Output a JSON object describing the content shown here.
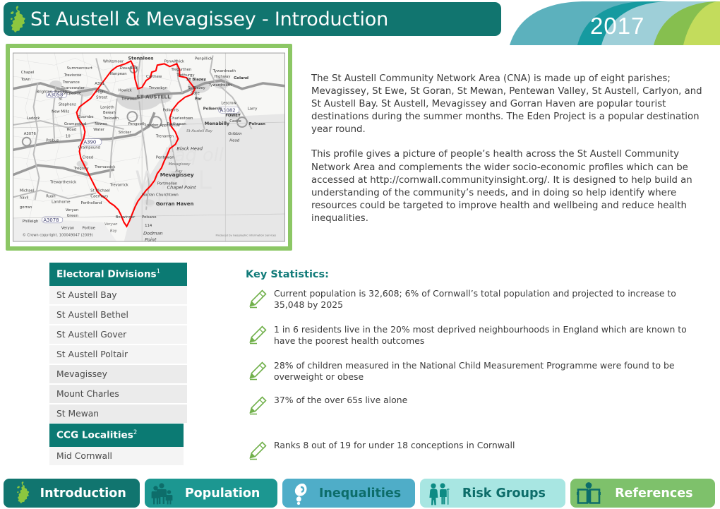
{
  "header": {
    "title": "St Austell & Mevagissey - Introduction",
    "year": "2017",
    "uk_icon": "uk-map-icon",
    "colors": {
      "title_bar": "#11756f",
      "swoosh_teal": "#5cb1bd",
      "swoosh_dark_teal": "#169aa0",
      "swoosh_light_teal": "#9ecfd8",
      "swoosh_green": "#86bf4f",
      "swoosh_light_green": "#c3dc5c"
    }
  },
  "map": {
    "name": "st-austell-cna-boundary-map",
    "boundary_color": "#ff0000",
    "frame_color": "#8cc765",
    "copyright": "© Crown copyright. 100049047 (2009)",
    "producer": "Produced by Geographic Information Services",
    "labels": [
      "Whitemoor",
      "Stenalees",
      "Penwithick",
      "Penpillick",
      "Nanpean",
      "Treviscoe",
      "Foxhole",
      "Carthew",
      "Tregurthen",
      "Trethurgy",
      "St Blazey",
      "Goland",
      "Chapel Town",
      "Scarcewater",
      "Stepaside",
      "St Stephens",
      "High Street",
      "Howick",
      "Trewoon",
      "Treverbyn",
      "St Blazey Gate",
      "Tywardreath Highway",
      "Tywardreath",
      "A3058",
      "New Mills",
      "Lanjeth",
      "Bethel",
      "Trewoth",
      "Par",
      "A3082",
      "Lescrow",
      "Ladock",
      "Coombe",
      "Trelowth",
      "Polkerris",
      "FOWEY",
      "Larry",
      "Grampound Road",
      "Nanpean",
      "Water",
      "Pengooth",
      "London Apprentice",
      "Charlestown",
      "Porthpean",
      "Menabilly",
      "Castle",
      "Polruan",
      "A390",
      "Probus",
      "Sticker",
      "Trenarren",
      "St Austell Bay",
      "Gribbin Head",
      "Grampound",
      "Creed",
      "Black Head",
      "Pentewan",
      "Mevagissey Bay",
      "Tregony",
      "Tremassick",
      "Mevagissey",
      "Portmellon",
      "Trewarthenick",
      "Trevarrick",
      "Chapel Point",
      "Gorran Churchtown",
      "St Michael Caerhays",
      "Ruan Lanihorne",
      "Portholland",
      "Gorran Haven",
      "Veryan Green",
      "Boswinger",
      "Polsano",
      "Philleigh",
      "A3078",
      "Portloe",
      "Veryan Bay",
      "Dodman Point",
      "ST AUSTELL",
      "CORNWALL COUNCIL",
      "114",
      "10"
    ]
  },
  "intro": {
    "paragraph1": "The St Austell Community Network Area (CNA) is made up of eight parishes; Mevagissey, St Ewe, St Goran, St Mewan, Pentewan Valley, St Austell, Carlyon, and St Austell Bay. St Austell, Mevagissey and Gorran Haven are popular tourist destinations during the summer months.  The Eden Project is a popular destination year round.",
    "paragraph2": "This profile gives a picture of people’s health across the St Austell Community Network Area and complements the wider socio-economic profiles which can be accessed at http://cornwall.communityinsight.org/. It is designed to help build an understanding of the community’s needs, and in doing so help identify where resources could be targeted to improve health and wellbeing and reduce health inequalities."
  },
  "electoral_divisions": {
    "header": "Electoral Divisions",
    "footnote": "1",
    "rows": [
      "St Austell Bay",
      "St Austell Bethel",
      "St Austell Gover",
      "St Austell Poltair",
      "Mevagissey",
      "Mount Charles",
      "St Mewan"
    ]
  },
  "ccg_localities": {
    "header": "CCG Localities",
    "footnote": "2",
    "rows": [
      "Mid Cornwall"
    ]
  },
  "key_statistics": {
    "title": "Key Statistics:",
    "icon": "highlighter-pen-icon",
    "icon_color": "#70b04a",
    "items": [
      "Current population is 32,608; 6% of Cornwall’s total population and projected to increase to 35,048 by 2025",
      "1 in 6 residents live in the 20% most deprived neighbourhoods in England which are known to have the poorest health outcomes",
      "28% of children measured in the National Child Measurement Programme were found to be overweight or obese",
      "37% of the over 65s live alone",
      "Ranks 8 out of 19 for under 18 conceptions in Cornwall"
    ]
  },
  "tabs": [
    {
      "label": "Introduction",
      "icon": "uk-map-icon",
      "bg": "#11756f",
      "fg": "#ffffff"
    },
    {
      "label": "Population",
      "icon": "family-icon",
      "bg": "#1c9791",
      "fg": "#ffffff"
    },
    {
      "label": "Inequalities",
      "icon": "magnifier-icon",
      "bg": "#4fadc8",
      "fg": "#0d6d6a"
    },
    {
      "label": "Risk Groups",
      "icon": "elderly-couple-icon",
      "bg": "#a8e6e2",
      "fg": "#0d6d6a"
    },
    {
      "label": "References",
      "icon": "open-book-icon",
      "bg": "#7ec16b",
      "fg": "#ffffff"
    }
  ]
}
